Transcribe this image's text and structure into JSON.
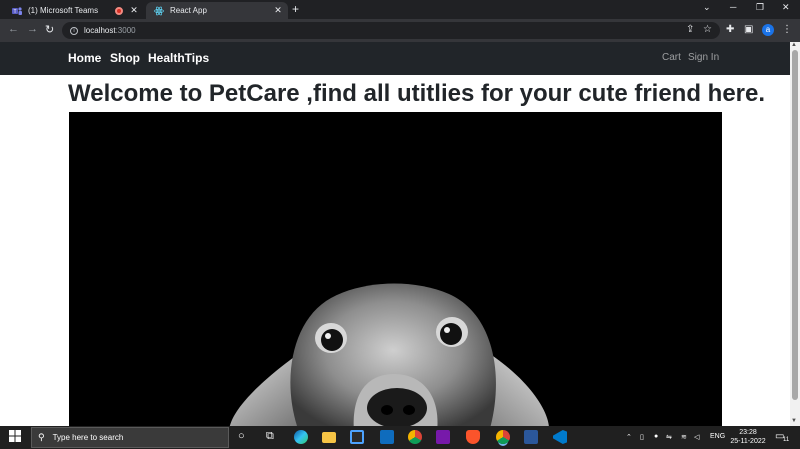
{
  "browser": {
    "tabs": [
      {
        "title": "(1) Microsoft Teams",
        "active": false
      },
      {
        "title": "React App",
        "active": true
      }
    ],
    "address": {
      "host": "localhost",
      "port": ":3000"
    },
    "profile_initial": "a"
  },
  "site": {
    "nav_left": [
      "Home",
      "Shop",
      "HealthTips"
    ],
    "nav_right": [
      "Cart",
      "Sign In"
    ],
    "headline": "Welcome to PetCare ,find all utitlies for your cute friend here.",
    "hero_image": "dachshund-peeking-photo"
  },
  "taskbar": {
    "search_placeholder": "Type here to search",
    "language": "ENG",
    "time": "23:28",
    "date": "25-11-2022",
    "notification_count": "11",
    "icons": [
      "start-icon",
      "search-icon",
      "cortana-icon",
      "task-view-icon",
      "edge-icon",
      "file-explorer-icon",
      "store-icon",
      "mail-icon",
      "chrome-icon",
      "onenote-icon",
      "brave-icon",
      "chrome-icon",
      "word-icon",
      "vscode-icon"
    ]
  },
  "colors": {
    "navbar": "#212529",
    "taskbar": "#202020",
    "browser_frame": "#202124",
    "accent_blue": "#1a73e8"
  }
}
